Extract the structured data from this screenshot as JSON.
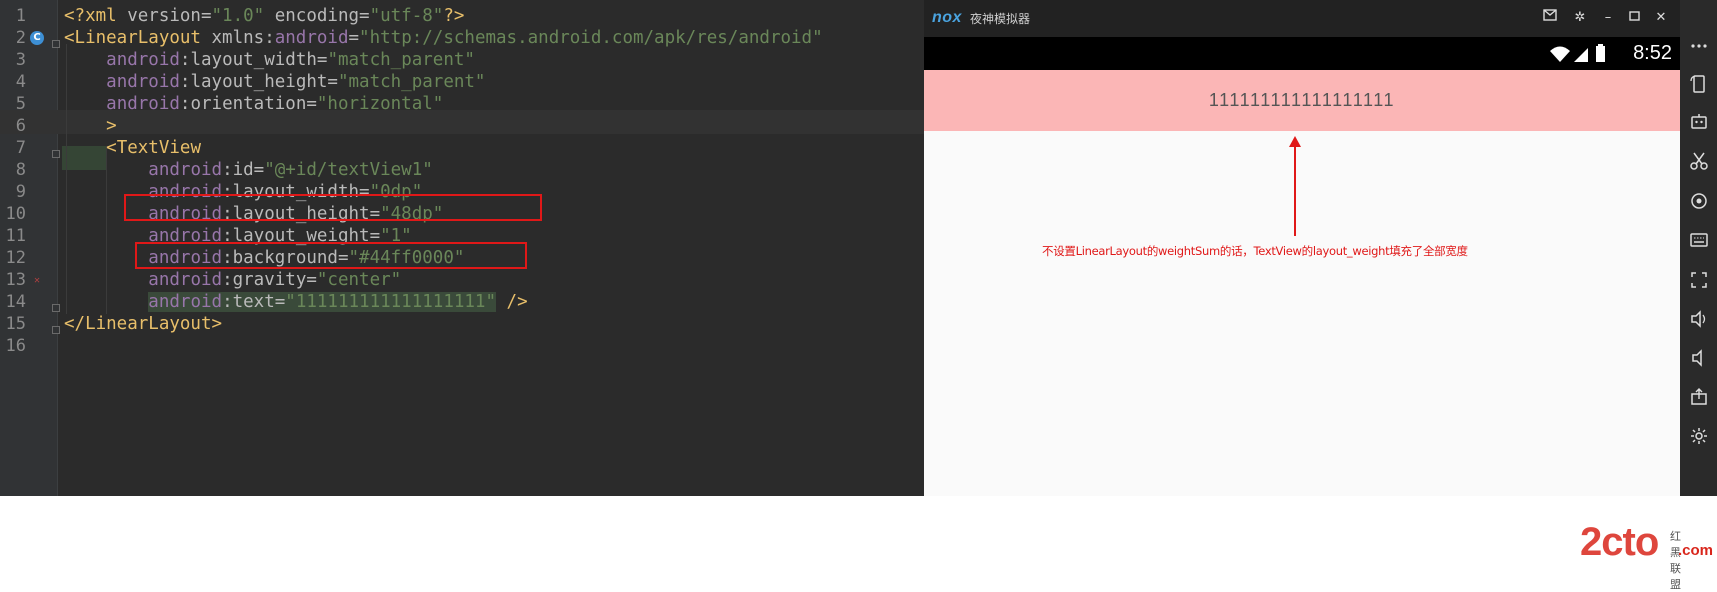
{
  "editor": {
    "lines": [
      {
        "n": "1",
        "parts": [
          {
            "c": "t-tag",
            "t": "<?xml "
          },
          {
            "c": "t-attr",
            "t": "version="
          },
          {
            "c": "t-val",
            "t": "\"1.0\""
          },
          {
            "c": "t-attr",
            "t": " encoding="
          },
          {
            "c": "t-val",
            "t": "\"utf-8\""
          },
          {
            "c": "t-tag",
            "t": "?>"
          }
        ]
      },
      {
        "n": "2",
        "parts": [
          {
            "c": "t-tag",
            "t": "<LinearLayout "
          },
          {
            "c": "t-attr",
            "t": "xmlns:"
          },
          {
            "c": "t-ns",
            "t": "android"
          },
          {
            "c": "t-attr",
            "t": "="
          },
          {
            "c": "t-val",
            "t": "\"http://schemas.android.com/apk/res/android\""
          }
        ]
      },
      {
        "n": "3",
        "parts": [
          {
            "c": "t-plain",
            "t": "    "
          },
          {
            "c": "t-ns",
            "t": "android"
          },
          {
            "c": "t-attr",
            "t": ":layout_width="
          },
          {
            "c": "t-val",
            "t": "\"match_parent\""
          }
        ]
      },
      {
        "n": "4",
        "parts": [
          {
            "c": "t-plain",
            "t": "    "
          },
          {
            "c": "t-ns",
            "t": "android"
          },
          {
            "c": "t-attr",
            "t": ":layout_height="
          },
          {
            "c": "t-val",
            "t": "\"match_parent\""
          }
        ]
      },
      {
        "n": "5",
        "parts": [
          {
            "c": "t-plain",
            "t": "    "
          },
          {
            "c": "t-ns",
            "t": "android"
          },
          {
            "c": "t-attr",
            "t": ":orientation="
          },
          {
            "c": "t-val",
            "t": "\"horizontal\""
          }
        ]
      },
      {
        "n": "6",
        "parts": [
          {
            "c": "t-plain",
            "t": "    "
          },
          {
            "c": "t-tag",
            "t": ">"
          }
        ]
      },
      {
        "n": "7",
        "parts": [
          {
            "c": "t-plain",
            "t": "    "
          },
          {
            "c": "t-tag",
            "t": "<TextView"
          }
        ]
      },
      {
        "n": "8",
        "parts": [
          {
            "c": "t-plain",
            "t": "        "
          },
          {
            "c": "t-ns",
            "t": "android"
          },
          {
            "c": "t-attr",
            "t": ":id="
          },
          {
            "c": "t-val",
            "t": "\"@+id/textView1\""
          }
        ]
      },
      {
        "n": "9",
        "parts": [
          {
            "c": "t-plain",
            "t": "        "
          },
          {
            "c": "t-ns",
            "t": "android"
          },
          {
            "c": "t-attr",
            "t": ":layout_width="
          },
          {
            "c": "t-val",
            "t": "\"0dp\""
          }
        ]
      },
      {
        "n": "10",
        "parts": [
          {
            "c": "t-plain",
            "t": "        "
          },
          {
            "c": "t-ns",
            "t": "android"
          },
          {
            "c": "t-attr",
            "t": ":layout_height="
          },
          {
            "c": "t-val",
            "t": "\"48dp\""
          }
        ]
      },
      {
        "n": "11",
        "parts": [
          {
            "c": "t-plain",
            "t": "        "
          },
          {
            "c": "t-ns",
            "t": "android"
          },
          {
            "c": "t-attr",
            "t": ":layout_weight="
          },
          {
            "c": "t-val",
            "t": "\"1\""
          }
        ]
      },
      {
        "n": "12",
        "parts": [
          {
            "c": "t-plain",
            "t": "        "
          },
          {
            "c": "t-ns",
            "t": "android"
          },
          {
            "c": "t-attr",
            "t": ":background="
          },
          {
            "c": "t-val",
            "t": "\"#44ff0000\""
          }
        ]
      },
      {
        "n": "13",
        "parts": [
          {
            "c": "t-plain",
            "t": "        "
          },
          {
            "c": "t-ns",
            "t": "android"
          },
          {
            "c": "t-attr",
            "t": ":gravity="
          },
          {
            "c": "t-val",
            "t": "\"center\""
          }
        ]
      },
      {
        "n": "14",
        "parts": [
          {
            "c": "t-plain",
            "t": "        "
          },
          {
            "c": "t-ns hl-text",
            "t": "android"
          },
          {
            "c": "t-attr hl-text",
            "t": ":text="
          },
          {
            "c": "t-val hl-text",
            "t": "\"111111111111111111\""
          },
          {
            "c": "t-tag",
            "t": " />"
          }
        ]
      },
      {
        "n": "15",
        "parts": [
          {
            "c": "t-tag",
            "t": "</LinearLayout>"
          }
        ]
      },
      {
        "n": "16",
        "parts": []
      }
    ]
  },
  "emulator": {
    "logo": "nox",
    "title": "夜神模拟器",
    "time": "8:52",
    "textview_text": "111111111111111111",
    "annotation": "不设置LinearLayout的weightSum的话，TextView的layout_weight填充了全部宽度",
    "watermark": "2cto",
    "watermark_sub": "红黑联盟",
    "watermark_domain": ".com"
  },
  "colors": {
    "editor_bg": "#2b2b2b",
    "tag": "#e8bf6a",
    "namespace": "#9876aa",
    "value": "#6a8759",
    "annotation_red": "#e01818",
    "textview_bg": "#fbb6b6"
  },
  "icons": {
    "window": [
      "mail-icon",
      "gear-icon",
      "minimize-icon",
      "maximize-icon",
      "close-icon"
    ],
    "sidebar": [
      "more-icon",
      "rotate-icon",
      "robot-icon",
      "scissors-icon",
      "location-icon",
      "keyboard-icon",
      "fullscreen-icon",
      "volume-up-icon",
      "volume-down-icon",
      "apk-install-icon",
      "settings-icon"
    ]
  }
}
